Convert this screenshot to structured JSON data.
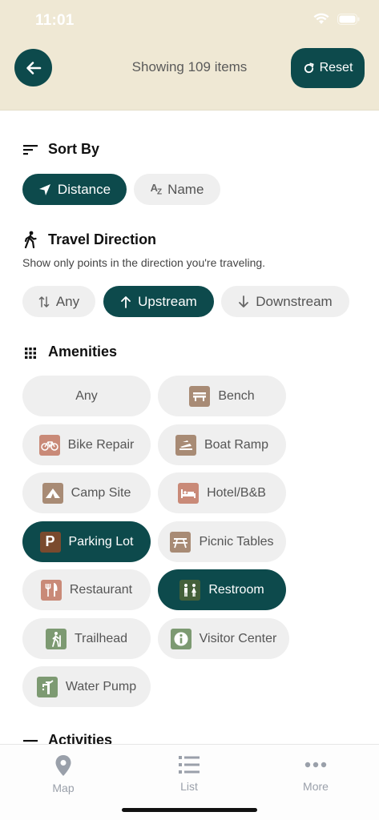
{
  "status": {
    "time": "11:01"
  },
  "header": {
    "title": "Showing 109 items",
    "reset_label": "Reset"
  },
  "sort": {
    "title": "Sort By",
    "options": [
      {
        "label": "Distance",
        "active": true
      },
      {
        "label": "Name",
        "active": false
      }
    ]
  },
  "direction": {
    "title": "Travel Direction",
    "subtitle": "Show only points in the direction you're traveling.",
    "options": [
      {
        "label": "Any",
        "active": false
      },
      {
        "label": "Upstream",
        "active": true
      },
      {
        "label": "Downstream",
        "active": false
      }
    ]
  },
  "amenities": {
    "title": "Amenities",
    "items": [
      {
        "label": "Any",
        "icon": "",
        "active": false
      },
      {
        "label": "Bench",
        "icon": "bench-icon",
        "active": false
      },
      {
        "label": "Bike Repair",
        "icon": "bike-icon",
        "active": false
      },
      {
        "label": "Boat Ramp",
        "icon": "boat-ramp-icon",
        "active": false
      },
      {
        "label": "Camp Site",
        "icon": "tent-icon",
        "active": false
      },
      {
        "label": "Hotel/B&B",
        "icon": "bed-icon",
        "active": false
      },
      {
        "label": "Parking Lot",
        "icon": "parking-icon",
        "active": true
      },
      {
        "label": "Picnic Tables",
        "icon": "picnic-table-icon",
        "active": false
      },
      {
        "label": "Restaurant",
        "icon": "fork-knife-icon",
        "active": false
      },
      {
        "label": "Restroom",
        "icon": "restroom-icon",
        "active": true
      },
      {
        "label": "Trailhead",
        "icon": "hiker-icon",
        "active": false
      },
      {
        "label": "Visitor Center",
        "icon": "info-icon",
        "active": false
      },
      {
        "label": "Water Pump",
        "icon": "water-pump-icon",
        "active": false
      }
    ]
  },
  "activities": {
    "title": "Activities"
  },
  "tabs": [
    {
      "label": "Map",
      "icon": "map-pin-icon"
    },
    {
      "label": "List",
      "icon": "list-icon"
    },
    {
      "label": "More",
      "icon": "more-icon"
    }
  ],
  "colors": {
    "accent": "#0d4a4c",
    "header_bg": "#efe8d4",
    "chip_bg": "#efefef",
    "icon_brown": "#a88b75",
    "icon_salmon": "#c98a78",
    "icon_green": "#7d9a72",
    "icon_dark_brown": "#7a4a2e",
    "icon_dark_green": "#44603a"
  }
}
